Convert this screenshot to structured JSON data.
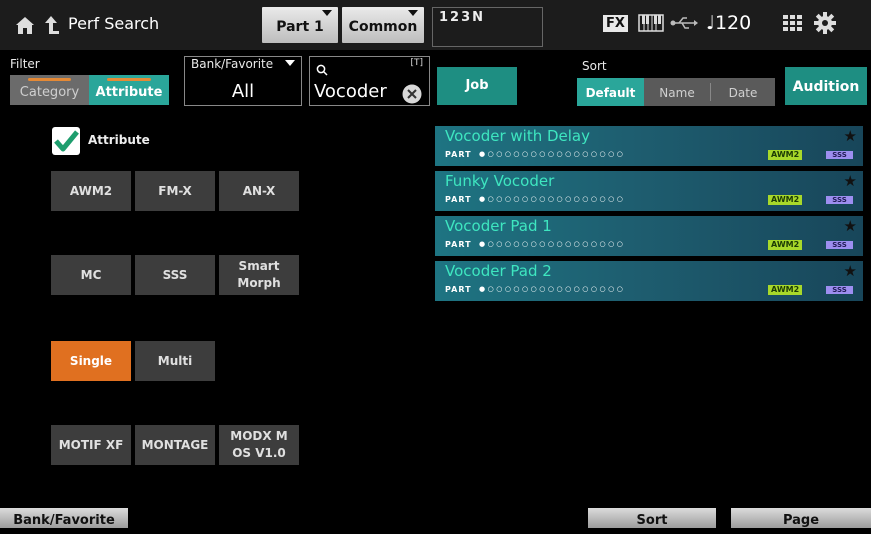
{
  "header": {
    "title": "Perf Search",
    "part_tab": "Part 1",
    "common_tab": "Common",
    "bank_indicator": "123N",
    "fx_label": "FX",
    "tempo": "♩120"
  },
  "filter": {
    "label": "Filter",
    "segments": [
      "Category",
      "Attribute"
    ],
    "selected": "Attribute",
    "accent_color": "#e58a36"
  },
  "bank_favorite": {
    "label": "Bank/Favorite",
    "value": "All"
  },
  "search": {
    "value": "Vocoder",
    "text_tag": "[T]"
  },
  "job_label": "Job",
  "sort": {
    "label": "Sort",
    "options": [
      "Default",
      "Name",
      "Date"
    ],
    "selected": "Default"
  },
  "audition_label": "Audition",
  "attribute_panel": {
    "checkbox_label": "Attribute",
    "checked": true,
    "buttons": [
      "AWM2",
      "FM-X",
      "AN-X",
      "MC",
      "SSS",
      "Smart Morph",
      "Single",
      "Multi",
      "MOTIF XF",
      "MONTAGE",
      "MODX M OS V1.0"
    ],
    "selected": "Single"
  },
  "results": [
    {
      "name": "Vocoder with Delay",
      "part_label": "PART",
      "badge_awm": "AWM2",
      "badge_sss": "SSS"
    },
    {
      "name": "Funky Vocoder",
      "part_label": "PART",
      "badge_awm": "AWM2",
      "badge_sss": "SSS"
    },
    {
      "name": "Vocoder Pad 1",
      "part_label": "PART",
      "badge_awm": "AWM2",
      "badge_sss": "SSS"
    },
    {
      "name": "Vocoder Pad 2",
      "part_label": "PART",
      "badge_awm": "AWM2",
      "badge_sss": "SSS"
    }
  ],
  "bottom_bar": {
    "bank_favorite": "Bank/Favorite",
    "sort": "Sort",
    "page": "Page"
  },
  "colors": {
    "teal": "#2aa69a",
    "selected_orange": "#e07020",
    "result_name": "#3ee6c0"
  }
}
